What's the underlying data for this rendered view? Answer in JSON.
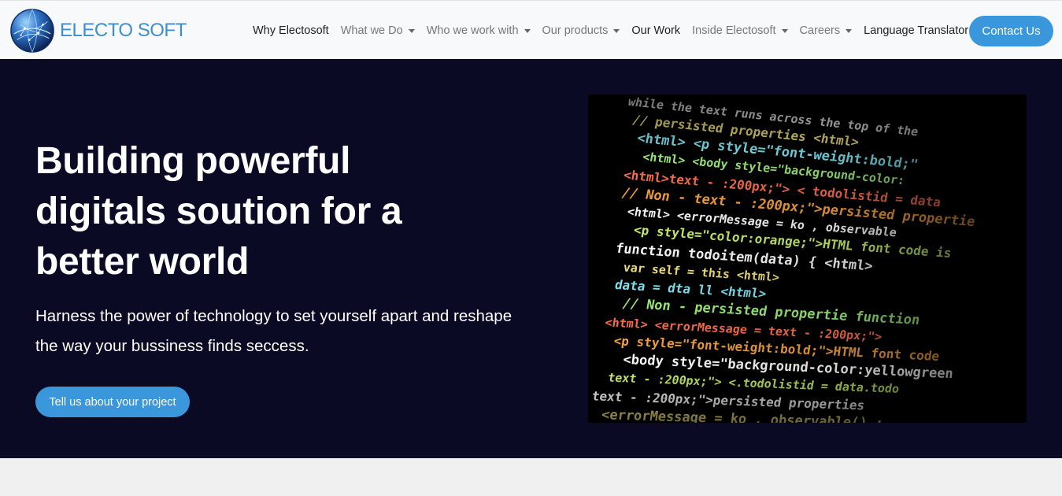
{
  "brand": {
    "name": "ELECTO SOFT",
    "logo_icon": "globe-network-icon",
    "color": "#3d8fd1"
  },
  "nav": {
    "items": [
      {
        "label": "Why Electosoft",
        "dropdown": false
      },
      {
        "label": "What we Do",
        "dropdown": true
      },
      {
        "label": "Who we work with",
        "dropdown": true
      },
      {
        "label": "Our products",
        "dropdown": true
      },
      {
        "label": "Our Work",
        "dropdown": false
      },
      {
        "label": "Inside Electosoft",
        "dropdown": true
      },
      {
        "label": "Careers",
        "dropdown": true
      },
      {
        "label": "Language Translator",
        "dropdown": false
      }
    ],
    "contact_label": "Contact Us"
  },
  "hero": {
    "title_lines": [
      "Building powerful",
      "digitals soution for a",
      "better world"
    ],
    "subtitle_lines": [
      "Harness the power of technology to set yourself apart and reshape",
      "the way your bussiness finds seccess."
    ],
    "cta_label": "Tell us about your project",
    "image": {
      "code_lines": [
        "while the text runs across the top of the",
        "// persisted properties <html>",
        "<html> <p style=\"font-weight:bold;\"",
        "<html> <body style=\"background-color:",
        "<html>text - :200px;\"> < todolistid = data",
        "// Non - text - :200px;\">persisted propertie",
        "<html> <errorMessage = ko , observable",
        "<p style=\"color:orange;\">HTML font code is",
        "function todoitem(data) { <html>",
        "var self = this <html>",
        "data = dta ll <html>",
        "// Non - persisted propertie function",
        "<html> <errorMessage = text - :200px;\">",
        "<p style=\"font-weight:bold;\">HTML font code",
        "<body style=\"background-color:yellowgreen",
        "text - :200px;\"> <.todolistid = data.todo",
        "text - :200px;\">persisted properties",
        "<errorMessage = ko , observable() ;"
      ]
    }
  },
  "colors": {
    "accent": "#3a97dc",
    "hero_bg": "#0a0a24",
    "nav_bg": "#f8f9fa",
    "page_bg": "#f0f0f0"
  }
}
